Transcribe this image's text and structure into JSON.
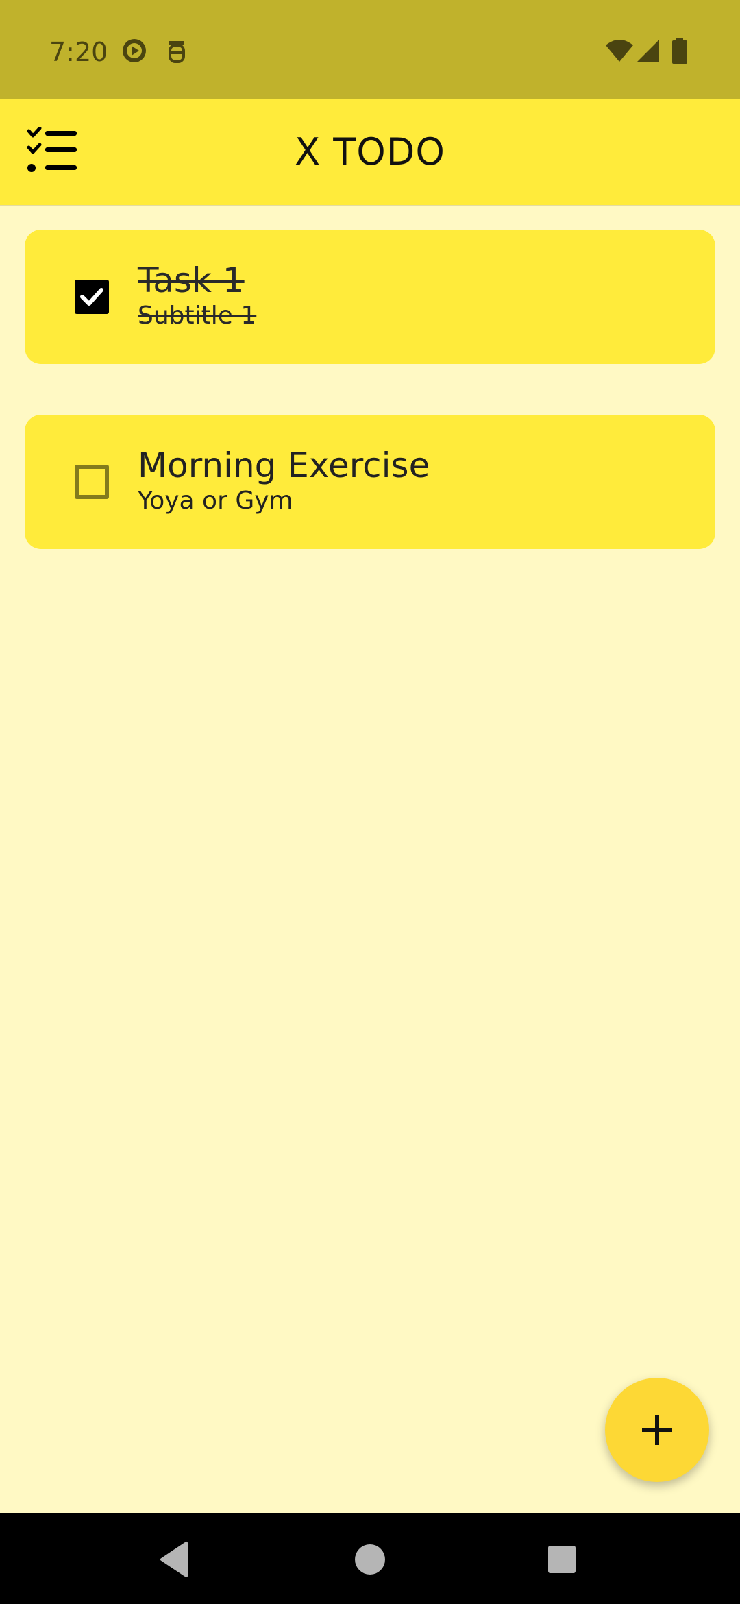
{
  "status_bar": {
    "time": "7:20",
    "icons": [
      "play-circle-icon",
      "bug-icon",
      "wifi-icon",
      "cellular-signal-icon",
      "battery-icon"
    ]
  },
  "app_bar": {
    "title": "X TODO",
    "menu_icon": "checklist-icon"
  },
  "tasks": [
    {
      "title": "Task 1",
      "subtitle": "Subtitle 1",
      "completed": true
    },
    {
      "title": "Morning Exercise",
      "subtitle": "Yoya or Gym",
      "completed": false
    }
  ],
  "fab": {
    "icon": "plus-icon"
  },
  "nav_bar": {
    "buttons": [
      "back-icon",
      "home-icon",
      "recents-icon"
    ]
  },
  "colors": {
    "status_bar": "#C0B22C",
    "app_bar": "#FFEB3B",
    "background": "#FFF9C4",
    "card": "#FFEB3B",
    "fab": "#FDD835",
    "nav_bar": "#000000"
  }
}
